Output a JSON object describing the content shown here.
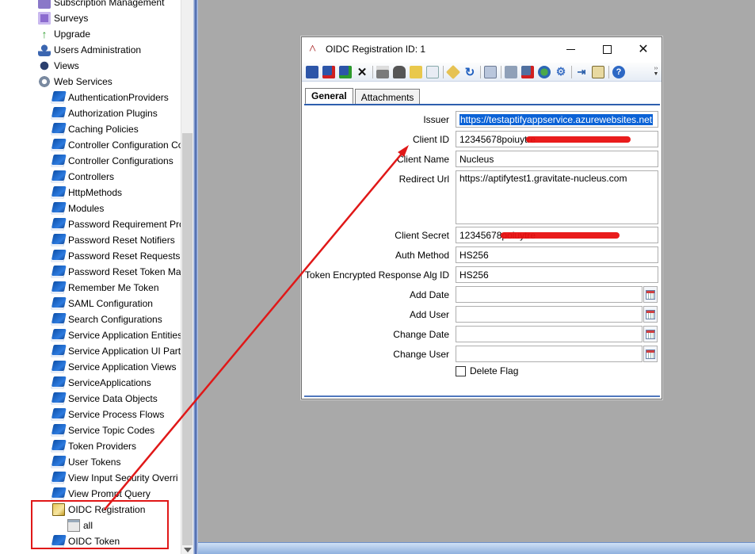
{
  "tree": {
    "items": [
      {
        "label": "Subscription Management",
        "icon": "subscription-icon"
      },
      {
        "label": "Surveys",
        "icon": "surveys-icon"
      },
      {
        "label": "Upgrade",
        "icon": "upgrade-arrow-icon"
      },
      {
        "label": "Users Administration",
        "icon": "users-icon"
      },
      {
        "label": "Views",
        "icon": "views-icon"
      },
      {
        "label": "Web Services",
        "icon": "web-services-gear-icon"
      },
      {
        "label": "AuthenticationProviders",
        "icon": "book-icon"
      },
      {
        "label": "Authorization Plugins",
        "icon": "book-icon"
      },
      {
        "label": "Caching Policies",
        "icon": "book-icon"
      },
      {
        "label": "Controller Configuration Co",
        "icon": "book-icon"
      },
      {
        "label": "Controller Configurations",
        "icon": "book-icon"
      },
      {
        "label": "Controllers",
        "icon": "book-icon"
      },
      {
        "label": "HttpMethods",
        "icon": "book-icon"
      },
      {
        "label": "Modules",
        "icon": "book-icon"
      },
      {
        "label": "Password Requirement Pro",
        "icon": "book-icon"
      },
      {
        "label": "Password Reset Notifiers",
        "icon": "book-icon"
      },
      {
        "label": "Password Reset Requests",
        "icon": "book-icon"
      },
      {
        "label": "Password Reset Token Man",
        "icon": "book-icon"
      },
      {
        "label": "Remember Me Token",
        "icon": "book-icon"
      },
      {
        "label": "SAML Configuration",
        "icon": "book-icon"
      },
      {
        "label": "Search Configurations",
        "icon": "book-icon"
      },
      {
        "label": "Service Application Entities",
        "icon": "book-icon"
      },
      {
        "label": "Service Application UI Part",
        "icon": "book-icon"
      },
      {
        "label": "Service Application Views",
        "icon": "book-icon"
      },
      {
        "label": "ServiceApplications",
        "icon": "book-icon"
      },
      {
        "label": "Service Data Objects",
        "icon": "book-icon"
      },
      {
        "label": "Service Process Flows",
        "icon": "book-icon"
      },
      {
        "label": "Service Topic Codes",
        "icon": "book-icon"
      },
      {
        "label": "Token Providers",
        "icon": "book-icon"
      },
      {
        "label": "User Tokens",
        "icon": "book-icon"
      },
      {
        "label": "View Input Security Overri",
        "icon": "book-icon"
      },
      {
        "label": "View Prompt Query",
        "icon": "book-icon"
      },
      {
        "label": "OIDC Registration",
        "icon": "open-book-icon"
      },
      {
        "label": "all",
        "icon": "all-view-icon"
      },
      {
        "label": "OIDC Token",
        "icon": "book-icon"
      }
    ]
  },
  "dialog": {
    "title": "OIDC Registration ID: 1",
    "tabs": [
      {
        "label": "General",
        "active": true
      },
      {
        "label": "Attachments",
        "active": false
      }
    ],
    "fields": {
      "issuer": {
        "label": "Issuer",
        "value": "https://testaptifyappservice.azurewebsites.net"
      },
      "client_id": {
        "label": "Client ID",
        "value": "12345678poiuytre"
      },
      "client_name": {
        "label": "Client Name",
        "value": "Nucleus"
      },
      "redirect_url": {
        "label": "Redirect Url",
        "value": "https://aptifytest1.gravitate-nucleus.com"
      },
      "client_secret": {
        "label": "Client Secret",
        "value": "12345678poiuytre"
      },
      "auth_method": {
        "label": "Auth Method",
        "value": "HS256"
      },
      "token_alg": {
        "label": "Token Encrypted Response Alg ID",
        "value": "HS256"
      },
      "add_date": {
        "label": "Add Date",
        "value": ""
      },
      "add_user": {
        "label": "Add User",
        "value": ""
      },
      "change_date": {
        "label": "Change Date",
        "value": ""
      },
      "change_user": {
        "label": "Change User",
        "value": ""
      },
      "delete_flag": {
        "label": "Delete Flag",
        "checked": false
      }
    }
  },
  "colors": {
    "annotation_red": "#e01818",
    "selection_blue": "#0b62d6",
    "tab_border_blue": "#2e5fae",
    "mdi_background": "#a9a9a9"
  }
}
